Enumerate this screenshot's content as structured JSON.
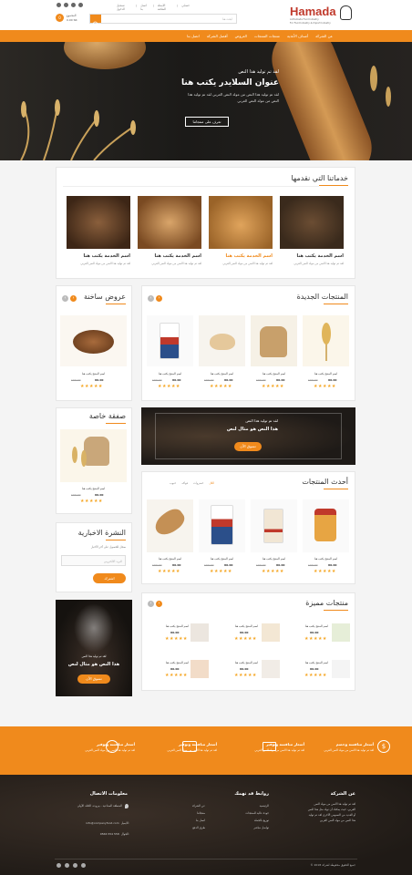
{
  "topbar": {
    "links": [
      "تسجيل الدخول",
      "اتصل بنا",
      "الأسئلة الشائعة",
      "حسابي"
    ],
    "search_placeholder": "ابحث هنا",
    "cart_label": "المجموع",
    "cart_total": "0.00 SR",
    "cart_count": "0"
  },
  "logo": {
    "name": "Hamada",
    "tagline1": "Al-Hamada Food Industry",
    "tagline2": "For Food Industry & Import Industry"
  },
  "nav": {
    "items": [
      "عن الشركة",
      "أصناف الأغذية",
      "منتجات المنتجات",
      "العروض",
      "أفضل الشركة",
      "اتصل بنا"
    ]
  },
  "hero": {
    "kicker": "لقد تم توليد هذا النص",
    "title": "عنوان السلايدر يكتب هنا",
    "text1": "لقد تم توليد هذا النص من مولد النص العربي لقد تم توليد هذا",
    "text2": "النص من مولد النص العربي",
    "button": "تعرف على منتجاتنا"
  },
  "services": {
    "title": "خدماتنا التي نقدمها",
    "items": [
      {
        "title": "اسم الخدمة يكتب هنا",
        "text": "لقد تم توليد هذا النص من مولد النص العربي"
      },
      {
        "title": "اسم الخدمة يكتب هنا",
        "text": "لقد تم توليد هذا النص من مولد النص العربي"
      },
      {
        "title": "اسم الخدمة يكتب هنا",
        "text": "لقد تم توليد هذا النص من مولد النص العربي"
      },
      {
        "title": "اسم الخدمة يكتب هنا",
        "text": "لقد تم توليد هذا النص من مولد النص العربي"
      }
    ]
  },
  "new_products": {
    "title": "المنتجات الجديدة",
    "items": [
      {
        "name": "اسم المنتج يكتب هنا",
        "old": "100.00",
        "price": "80.00"
      },
      {
        "name": "اسم المنتج يكتب هنا",
        "old": "100.00",
        "price": "80.00"
      },
      {
        "name": "اسم المنتج يكتب هنا",
        "old": "100.00",
        "price": "80.00"
      },
      {
        "name": "اسم المنتج يكتب هنا",
        "old": "100.00",
        "price": "80.00"
      }
    ]
  },
  "hot_offers": {
    "title": "عروض ساخنة",
    "product": {
      "name": "اسم المنتج يكتب هنا",
      "old": "100.00",
      "price": "80.00"
    }
  },
  "special_deal": {
    "title": "صفقة خاصة",
    "product": {
      "name": "اسم المنتج يكتب هنا",
      "old": "100.00",
      "price": "80.00"
    }
  },
  "banner": {
    "kicker": "لقد تم توليد هذا النص",
    "title": "هذا النص هو مثال لنص",
    "button": "تسوق الآن"
  },
  "latest": {
    "title": "أحدث المنتجات",
    "tabs": [
      "الكل",
      "خضروات",
      "فواكه",
      "حبوب"
    ],
    "items": [
      {
        "name": "اسم المنتج يكتب هنا",
        "old": "100.00",
        "price": "80.00"
      },
      {
        "name": "اسم المنتج يكتب هنا",
        "old": "100.00",
        "price": "80.00"
      },
      {
        "name": "اسم المنتج يكتب هنا",
        "old": "100.00",
        "price": "80.00"
      },
      {
        "name": "اسم المنتج يكتب هنا",
        "old": "100.00",
        "price": "80.00"
      }
    ]
  },
  "newsletter": {
    "title": "النشرة الاخبارية",
    "text": "سجل للحصول على آخر الأخبار",
    "placeholder": "البريد الالكتروني",
    "button": "اشترك"
  },
  "promo": {
    "kicker": "لقد تم توليد هذا النص",
    "title": "هذا النص هو مثال لنص",
    "button": "تسوق الآن"
  },
  "featured": {
    "title": "منتجات مميزة",
    "items": [
      {
        "name": "اسم المنتج يكتب هنا",
        "price": "80.00"
      },
      {
        "name": "اسم المنتج يكتب هنا",
        "price": "80.00"
      },
      {
        "name": "اسم المنتج يكتب هنا",
        "price": "80.00"
      },
      {
        "name": "اسم المنتج يكتب هنا",
        "price": "80.00"
      },
      {
        "name": "اسم المنتج يكتب هنا",
        "price": "80.00"
      },
      {
        "name": "اسم المنتج يكتب هنا",
        "price": "80.00"
      }
    ]
  },
  "features": {
    "items": [
      {
        "title": "أسعار منافسة وخصم",
        "text": "لقد تم توليد هذا النص من مولد النص العربي"
      },
      {
        "title": "أسعار منافسة وتوفير",
        "text": "لقد تم توليد هذا النص من مولد النص العربي"
      },
      {
        "title": "أسعار منافسة وتوفير",
        "text": "لقد تم توليد هذا النص من مولد النص العربي"
      },
      {
        "title": "أسعار منافسة وتوفير",
        "text": "لقد تم توليد هذا النص من مولد النص العربي"
      },
      {
        "title": "أسعار منافسة وتوفير",
        "text": "لقد تم توليد هذا النص من مولد النص العربي"
      }
    ]
  },
  "footer": {
    "about_title": "عن الشركة",
    "about_text": [
      "لقد تم توليد هذا النص من مولد النص",
      "العربي، حيث يمكنك أن تولد مثل هذا النص",
      "أو العديد من النصوص الأخرى لقد تم توليد",
      "هذا النص من مولد النص العربي"
    ],
    "links_title": "روابط قد تهمك",
    "links_col1": [
      "الرئيسية",
      "جودة عالية للمنتجات",
      "توزيع بالجملة",
      "تواصل مباشر"
    ],
    "links_col2": [
      "عن الشركة",
      "منتجاتنا",
      "اتصل بنا",
      "طرق الدفع"
    ],
    "contact_title": "معلومات الاتصال",
    "address": "المنطقة الصناعية - بيروت، الكتلة الأولى",
    "email_label": "الايميل:",
    "email": "info@companyfood.com",
    "phone_label": "الجوال:",
    "phone": "0566 554 558",
    "copyright": "جميع الحقوق محفوظة لشركة 2018 ©"
  },
  "colors": {
    "accent": "#f08a1c",
    "dark": "#2a2521"
  }
}
